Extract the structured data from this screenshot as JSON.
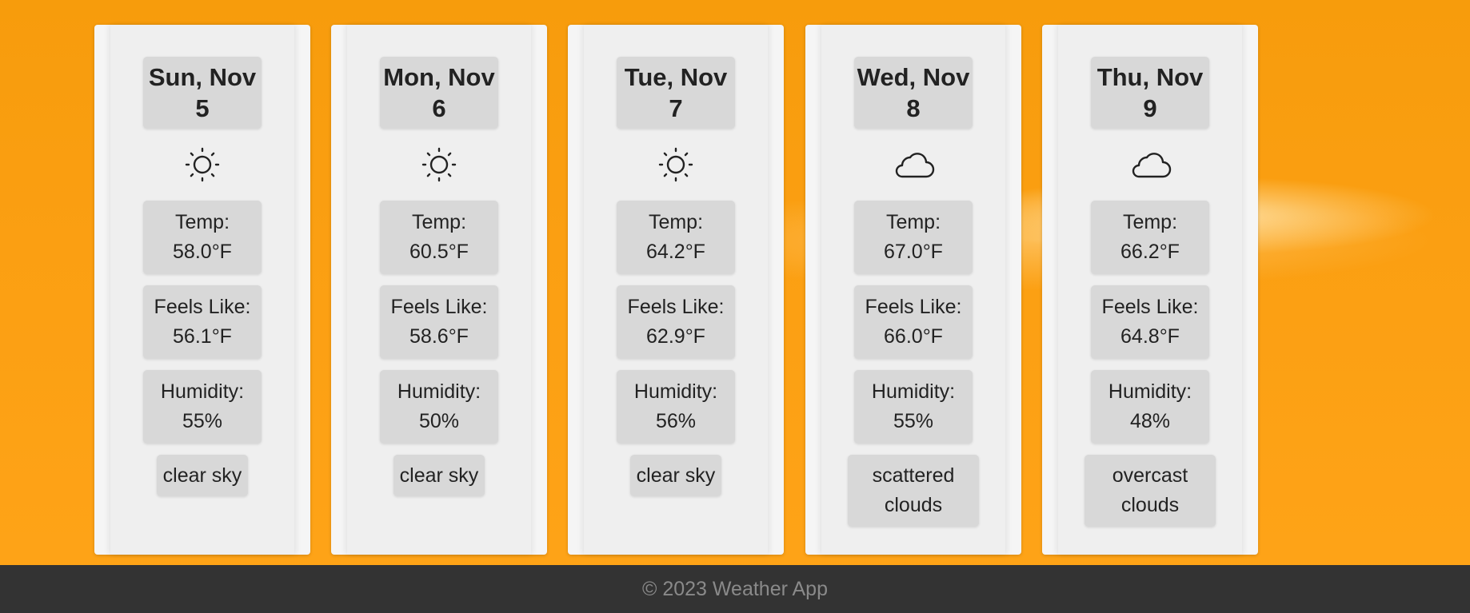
{
  "days": [
    {
      "date": "Sun, Nov 5",
      "icon": "sun-icon",
      "temp_label": "Temp:",
      "temp": "58.0°F",
      "feels_label": "Feels Like:",
      "feels": "56.1°F",
      "humidity_label": "Humidity:",
      "humidity": "55%",
      "description": "clear sky"
    },
    {
      "date": "Mon, Nov 6",
      "icon": "sun-icon",
      "temp_label": "Temp:",
      "temp": "60.5°F",
      "feels_label": "Feels Like:",
      "feels": "58.6°F",
      "humidity_label": "Humidity:",
      "humidity": "50%",
      "description": "clear sky"
    },
    {
      "date": "Tue, Nov 7",
      "icon": "sun-icon",
      "temp_label": "Temp:",
      "temp": "64.2°F",
      "feels_label": "Feels Like:",
      "feels": "62.9°F",
      "humidity_label": "Humidity:",
      "humidity": "56%",
      "description": "clear sky"
    },
    {
      "date": "Wed, Nov 8",
      "icon": "cloud-icon",
      "temp_label": "Temp:",
      "temp": "67.0°F",
      "feels_label": "Feels Like:",
      "feels": "66.0°F",
      "humidity_label": "Humidity:",
      "humidity": "55%",
      "description": "scattered clouds"
    },
    {
      "date": "Thu, Nov 9",
      "icon": "cloud-icon",
      "temp_label": "Temp:",
      "temp": "66.2°F",
      "feels_label": "Feels Like:",
      "feels": "64.8°F",
      "humidity_label": "Humidity:",
      "humidity": "48%",
      "description": "overcast clouds"
    }
  ],
  "footer": {
    "text": "© 2023 Weather App"
  },
  "colors": {
    "background": "#fb9f12",
    "card": "#f5f5f5",
    "box": "#d8d8d8",
    "footer": "#333333",
    "footer_text": "#8a8a8a"
  }
}
